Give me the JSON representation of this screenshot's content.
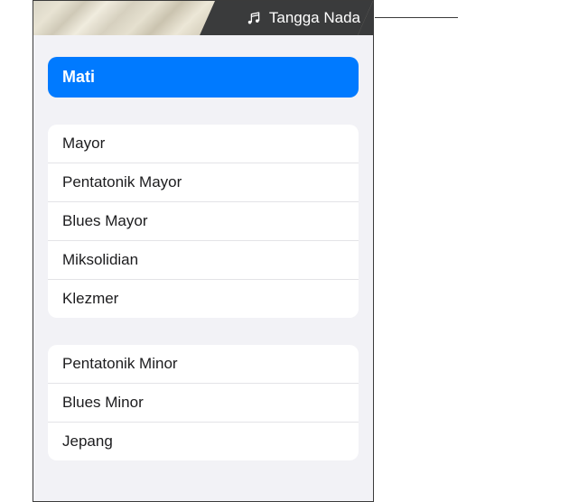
{
  "header": {
    "button_label": "Tangga Nada"
  },
  "selected": {
    "label": "Mati"
  },
  "groups": [
    {
      "items": [
        {
          "label": "Mayor"
        },
        {
          "label": "Pentatonik Mayor"
        },
        {
          "label": "Blues Mayor"
        },
        {
          "label": "Miksolidian"
        },
        {
          "label": "Klezmer"
        }
      ]
    },
    {
      "items": [
        {
          "label": "Pentatonik Minor"
        },
        {
          "label": "Blues Minor"
        },
        {
          "label": "Jepang"
        }
      ]
    }
  ]
}
